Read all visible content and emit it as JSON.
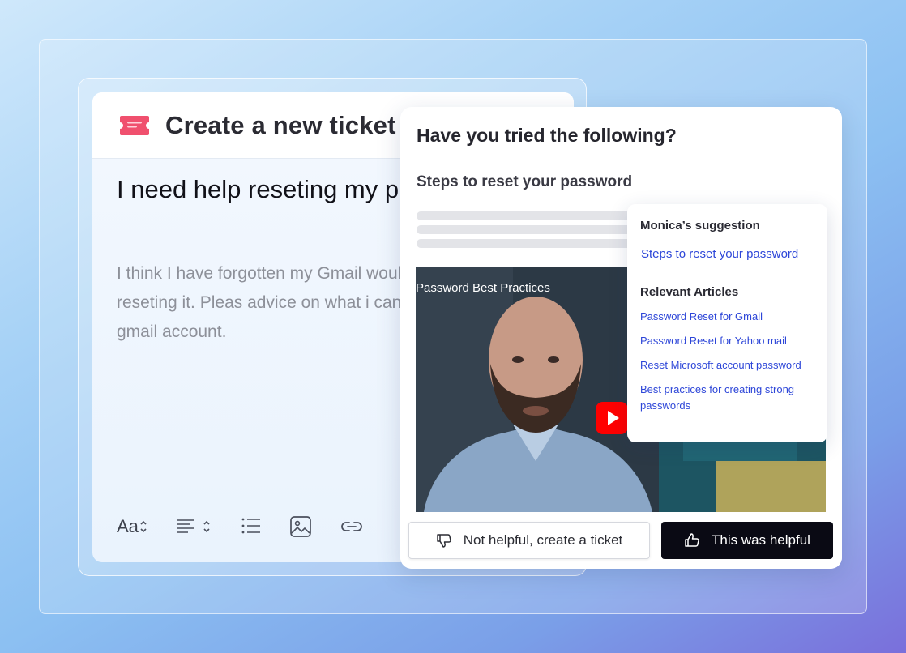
{
  "ticket": {
    "title": "Create a new ticket",
    "subject": "I need help reseting my password",
    "body": "I think I have forgotten my Gmail would need help reseting it. Pleas advice on what i can do to regain gmail account.",
    "toolbar": {
      "font_label": "Aa",
      "icons": [
        "chevron-updown-icon",
        "align-left-icon",
        "list-icon",
        "image-icon",
        "link-icon"
      ]
    }
  },
  "suggestion_panel": {
    "title": "Have you tried the following?",
    "subtitle": "Steps to reset your password",
    "video": {
      "title": "Password Best Practices"
    },
    "buttons": {
      "not_helpful": "Not helpful, create a ticket",
      "helpful": "This was helpful"
    }
  },
  "monica": {
    "heading": "Monica’s suggestion",
    "main_link": "Steps to reset your password",
    "relevant_heading": "Relevant Articles",
    "articles": [
      "Password Reset for Gmail",
      "Password Reset for Yahoo mail",
      "Reset Microsoft account password",
      "Best practices for creating strong passwords"
    ]
  },
  "colors": {
    "accent_link": "#2d46d8",
    "ticket_icon": "#f0506e",
    "primary_button": "#0a0a14"
  }
}
